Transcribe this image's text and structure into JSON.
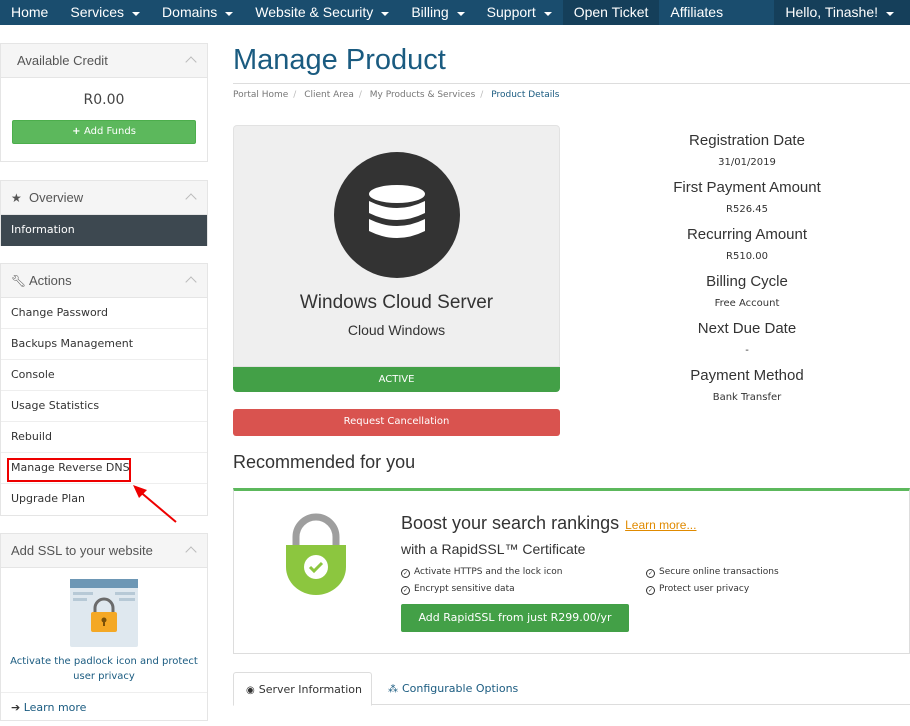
{
  "nav": {
    "items": [
      {
        "label": "Home",
        "caret": false
      },
      {
        "label": "Services",
        "caret": true
      },
      {
        "label": "Domains",
        "caret": true
      },
      {
        "label": "Website & Security",
        "caret": true
      },
      {
        "label": "Billing",
        "caret": true
      },
      {
        "label": "Support",
        "caret": true
      },
      {
        "label": "Open Ticket",
        "caret": false
      },
      {
        "label": "Affiliates",
        "caret": false
      }
    ],
    "user_greeting": "Hello, Tinashe!"
  },
  "sidebar": {
    "credit": {
      "title": "Available Credit",
      "value": "R0.00",
      "add_funds": "Add Funds"
    },
    "overview": {
      "title": "Overview",
      "items": [
        "Information"
      ]
    },
    "actions": {
      "title": "Actions",
      "items": [
        "Change Password",
        "Backups Management",
        "Console",
        "Usage Statistics",
        "Rebuild",
        "Manage Reverse DNS",
        "Upgrade Plan"
      ]
    },
    "ssl": {
      "title": "Add SSL to your website",
      "text": "Activate the padlock icon and protect user privacy",
      "learn_more": "Learn more"
    }
  },
  "main": {
    "title": "Manage Product",
    "breadcrumb": [
      "Portal Home",
      "Client Area",
      "My Products & Services",
      "Product Details"
    ],
    "product": {
      "name": "Windows Cloud Server",
      "group": "Cloud Windows",
      "status": "ACTIVE",
      "cancel_label": "Request Cancellation"
    },
    "details": [
      {
        "label": "Registration Date",
        "value": "31/01/2019"
      },
      {
        "label": "First Payment Amount",
        "value": "R526.45"
      },
      {
        "label": "Recurring Amount",
        "value": "R510.00"
      },
      {
        "label": "Billing Cycle",
        "value": "Free Account"
      },
      {
        "label": "Next Due Date",
        "value": "-"
      },
      {
        "label": "Payment Method",
        "value": "Bank Transfer"
      }
    ],
    "recommended": {
      "title": "Recommended for you",
      "headline": "Boost your search rankings",
      "learn_more": "Learn more...",
      "subtitle": "with a RapidSSL™ Certificate",
      "features": [
        "Activate HTTPS and the lock icon",
        "Encrypt sensitive data",
        "Secure online transactions",
        "Protect user privacy"
      ],
      "button": "Add RapidSSL from just R299.00/yr"
    },
    "tabs": [
      "Server Information",
      "Configurable Options"
    ]
  },
  "colors": {
    "nav_bg": "#1a4d6e",
    "accent": "#1a5b80",
    "success": "#43a047",
    "danger": "#d9534f",
    "highlight": "#e00000"
  }
}
